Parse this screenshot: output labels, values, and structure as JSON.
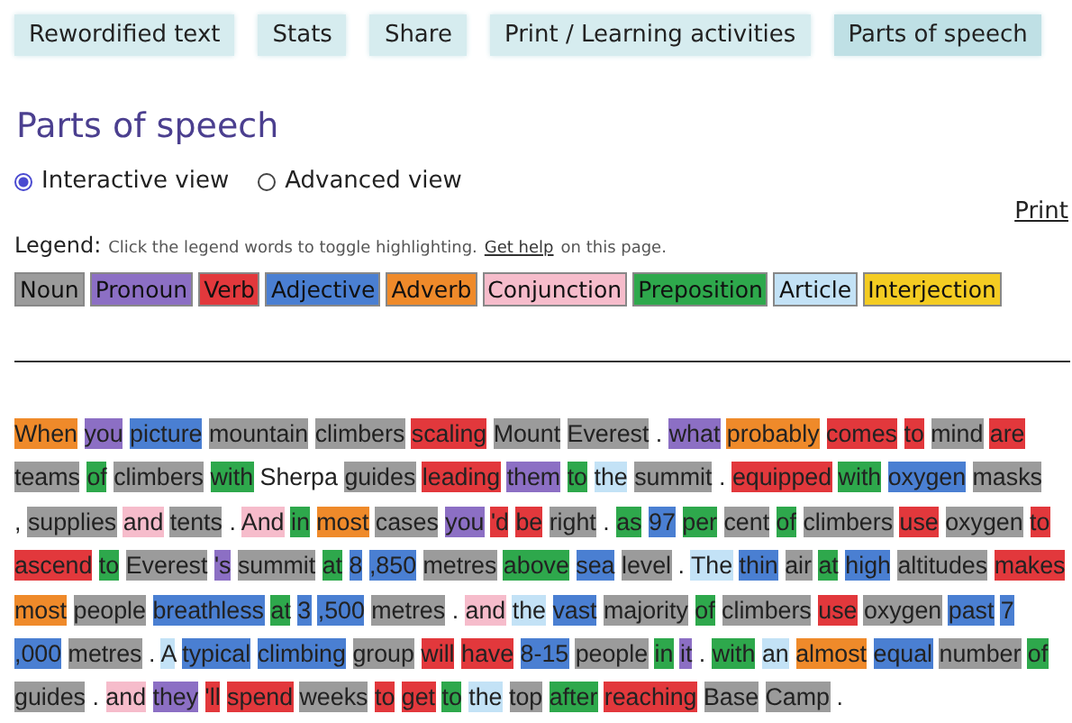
{
  "tabs": [
    {
      "label": "Rewordified text",
      "selected": false
    },
    {
      "label": "Stats",
      "selected": false
    },
    {
      "label": "Share",
      "selected": false
    },
    {
      "label": "Print / Learning activities",
      "selected": false
    },
    {
      "label": "Parts of speech",
      "selected": true
    }
  ],
  "heading": "Parts of speech",
  "views": [
    {
      "label": "Interactive view",
      "selected": true
    },
    {
      "label": "Advanced view",
      "selected": false
    }
  ],
  "print_link": "Print",
  "legend": {
    "label": "Legend:",
    "hint": "Click the legend words to toggle highlighting.",
    "help_link": "Get help",
    "hint_end": "on this page.",
    "items": [
      {
        "label": "Noun",
        "color": "#9b9b9b"
      },
      {
        "label": "Pronoun",
        "color": "#8c6fc4"
      },
      {
        "label": "Verb",
        "color": "#e2383c"
      },
      {
        "label": "Adjective",
        "color": "#4a7fd2"
      },
      {
        "label": "Adverb",
        "color": "#ef8a2a"
      },
      {
        "label": "Conjunction",
        "color": "#f6bccb"
      },
      {
        "label": "Preposition",
        "color": "#2ea84c"
      },
      {
        "label": "Article",
        "color": "#c3e2f6"
      },
      {
        "label": "Interjection",
        "color": "#f4cc22"
      }
    ]
  },
  "lines": [
    [
      {
        "t": "When",
        "color": "#ef8a2a"
      },
      {
        "t": "you",
        "color": "#8c6fc4"
      },
      {
        "t": "picture",
        "color": "#4a7fd2"
      },
      {
        "t": "mountain",
        "color": "#9b9b9b"
      },
      {
        "t": "climbers",
        "color": "#9b9b9b"
      },
      {
        "t": "scaling",
        "color": "#e2383c"
      },
      {
        "t": "Mount",
        "color": "#9b9b9b"
      },
      {
        "t": "Everest",
        "color": "#9b9b9b"
      },
      {
        "t": "."
      },
      {
        "t": "what",
        "color": "#8c6fc4"
      },
      {
        "t": "probably",
        "color": "#ef8a2a"
      },
      {
        "t": "comes",
        "color": "#e2383c"
      },
      {
        "t": "to",
        "color": "#e2383c"
      },
      {
        "t": "mind",
        "color": "#9b9b9b"
      },
      {
        "t": "are",
        "color": "#e2383c"
      }
    ],
    [
      {
        "t": "teams",
        "color": "#9b9b9b"
      },
      {
        "t": "of",
        "color": "#2ea84c"
      },
      {
        "t": "climbers",
        "color": "#9b9b9b"
      },
      {
        "t": "with",
        "color": "#2ea84c"
      },
      {
        "t": "Sherpa"
      },
      {
        "t": "guides",
        "color": "#9b9b9b"
      },
      {
        "t": "leading",
        "color": "#e2383c"
      },
      {
        "t": "them",
        "color": "#8c6fc4"
      },
      {
        "t": "to",
        "color": "#2ea84c"
      },
      {
        "t": "the",
        "color": "#c3e2f6"
      },
      {
        "t": "summit",
        "color": "#9b9b9b"
      },
      {
        "t": "."
      },
      {
        "t": "equipped",
        "color": "#e2383c"
      },
      {
        "t": "with",
        "color": "#2ea84c"
      },
      {
        "t": "oxygen",
        "color": "#4a7fd2"
      },
      {
        "t": "masks",
        "color": "#9b9b9b"
      }
    ],
    [
      {
        "t": ","
      },
      {
        "t": "supplies",
        "color": "#9b9b9b"
      },
      {
        "t": "and",
        "color": "#f6bccb"
      },
      {
        "t": "tents",
        "color": "#9b9b9b"
      },
      {
        "t": "."
      },
      {
        "t": "And",
        "color": "#f6bccb"
      },
      {
        "t": "in",
        "color": "#2ea84c"
      },
      {
        "t": "most",
        "color": "#ef8a2a"
      },
      {
        "t": "cases",
        "color": "#9b9b9b"
      },
      {
        "t": "you",
        "color": "#8c6fc4"
      },
      {
        "t": "'d",
        "color": "#e2383c"
      },
      {
        "t": "be",
        "color": "#e2383c"
      },
      {
        "t": "right",
        "color": "#9b9b9b"
      },
      {
        "t": "."
      },
      {
        "t": "as",
        "color": "#2ea84c"
      },
      {
        "t": "97",
        "color": "#4a7fd2"
      },
      {
        "t": "per",
        "color": "#2ea84c"
      },
      {
        "t": "cent",
        "color": "#9b9b9b"
      },
      {
        "t": "of",
        "color": "#2ea84c"
      },
      {
        "t": "climbers",
        "color": "#9b9b9b"
      },
      {
        "t": "use",
        "color": "#e2383c"
      },
      {
        "t": "oxygen",
        "color": "#9b9b9b"
      },
      {
        "t": "to",
        "color": "#e2383c"
      }
    ],
    [
      {
        "t": "ascend",
        "color": "#e2383c"
      },
      {
        "t": "to",
        "color": "#2ea84c"
      },
      {
        "t": "Everest",
        "color": "#9b9b9b"
      },
      {
        "t": "'s",
        "color": "#8c6fc4"
      },
      {
        "t": "summit",
        "color": "#9b9b9b"
      },
      {
        "t": "at",
        "color": "#2ea84c"
      },
      {
        "t": "8",
        "color": "#4a7fd2"
      },
      {
        "t": ",850",
        "color": "#4a7fd2"
      },
      {
        "t": "metres",
        "color": "#9b9b9b"
      },
      {
        "t": "above",
        "color": "#2ea84c"
      },
      {
        "t": "sea",
        "color": "#4a7fd2"
      },
      {
        "t": "level",
        "color": "#9b9b9b"
      },
      {
        "t": "."
      },
      {
        "t": "The",
        "color": "#c3e2f6"
      },
      {
        "t": "thin",
        "color": "#4a7fd2"
      },
      {
        "t": "air",
        "color": "#9b9b9b"
      },
      {
        "t": "at",
        "color": "#2ea84c"
      },
      {
        "t": "high",
        "color": "#4a7fd2"
      },
      {
        "t": "altitudes",
        "color": "#9b9b9b"
      },
      {
        "t": "makes",
        "color": "#e2383c"
      }
    ],
    [
      {
        "t": "most",
        "color": "#ef8a2a"
      },
      {
        "t": "people",
        "color": "#9b9b9b"
      },
      {
        "t": "breathless",
        "color": "#4a7fd2"
      },
      {
        "t": "at",
        "color": "#2ea84c"
      },
      {
        "t": "3",
        "color": "#4a7fd2"
      },
      {
        "t": ",500",
        "color": "#4a7fd2"
      },
      {
        "t": "metres",
        "color": "#9b9b9b"
      },
      {
        "t": "."
      },
      {
        "t": "and",
        "color": "#f6bccb"
      },
      {
        "t": "the",
        "color": "#c3e2f6"
      },
      {
        "t": "vast",
        "color": "#4a7fd2"
      },
      {
        "t": "majority",
        "color": "#9b9b9b"
      },
      {
        "t": "of",
        "color": "#2ea84c"
      },
      {
        "t": "climbers",
        "color": "#9b9b9b"
      },
      {
        "t": "use",
        "color": "#e2383c"
      },
      {
        "t": "oxygen",
        "color": "#9b9b9b"
      },
      {
        "t": "past",
        "color": "#4a7fd2"
      },
      {
        "t": "7",
        "color": "#4a7fd2"
      }
    ],
    [
      {
        "t": ",000",
        "color": "#4a7fd2"
      },
      {
        "t": "metres",
        "color": "#9b9b9b"
      },
      {
        "t": "."
      },
      {
        "t": "A",
        "color": "#c3e2f6"
      },
      {
        "t": "typical",
        "color": "#4a7fd2"
      },
      {
        "t": "climbing",
        "color": "#4a7fd2"
      },
      {
        "t": "group",
        "color": "#9b9b9b"
      },
      {
        "t": "will",
        "color": "#e2383c"
      },
      {
        "t": "have",
        "color": "#e2383c"
      },
      {
        "t": "8-15",
        "color": "#4a7fd2"
      },
      {
        "t": "people",
        "color": "#9b9b9b"
      },
      {
        "t": "in",
        "color": "#2ea84c"
      },
      {
        "t": "it",
        "color": "#8c6fc4"
      },
      {
        "t": "."
      },
      {
        "t": "with",
        "color": "#2ea84c"
      },
      {
        "t": "an",
        "color": "#c3e2f6"
      },
      {
        "t": "almost",
        "color": "#ef8a2a"
      },
      {
        "t": "equal",
        "color": "#4a7fd2"
      },
      {
        "t": "number",
        "color": "#9b9b9b"
      },
      {
        "t": "of",
        "color": "#2ea84c"
      }
    ],
    [
      {
        "t": "guides",
        "color": "#9b9b9b"
      },
      {
        "t": "."
      },
      {
        "t": "and",
        "color": "#f6bccb"
      },
      {
        "t": "they",
        "color": "#8c6fc4"
      },
      {
        "t": "'ll",
        "color": "#e2383c"
      },
      {
        "t": "spend",
        "color": "#e2383c"
      },
      {
        "t": "weeks",
        "color": "#9b9b9b"
      },
      {
        "t": "to",
        "color": "#e2383c"
      },
      {
        "t": "get",
        "color": "#e2383c"
      },
      {
        "t": "to",
        "color": "#2ea84c"
      },
      {
        "t": "the",
        "color": "#c3e2f6"
      },
      {
        "t": "top",
        "color": "#9b9b9b"
      },
      {
        "t": "after",
        "color": "#2ea84c"
      },
      {
        "t": "reaching",
        "color": "#e2383c"
      },
      {
        "t": "Base",
        "color": "#9b9b9b"
      },
      {
        "t": "Camp",
        "color": "#9b9b9b"
      },
      {
        "t": "."
      }
    ]
  ]
}
